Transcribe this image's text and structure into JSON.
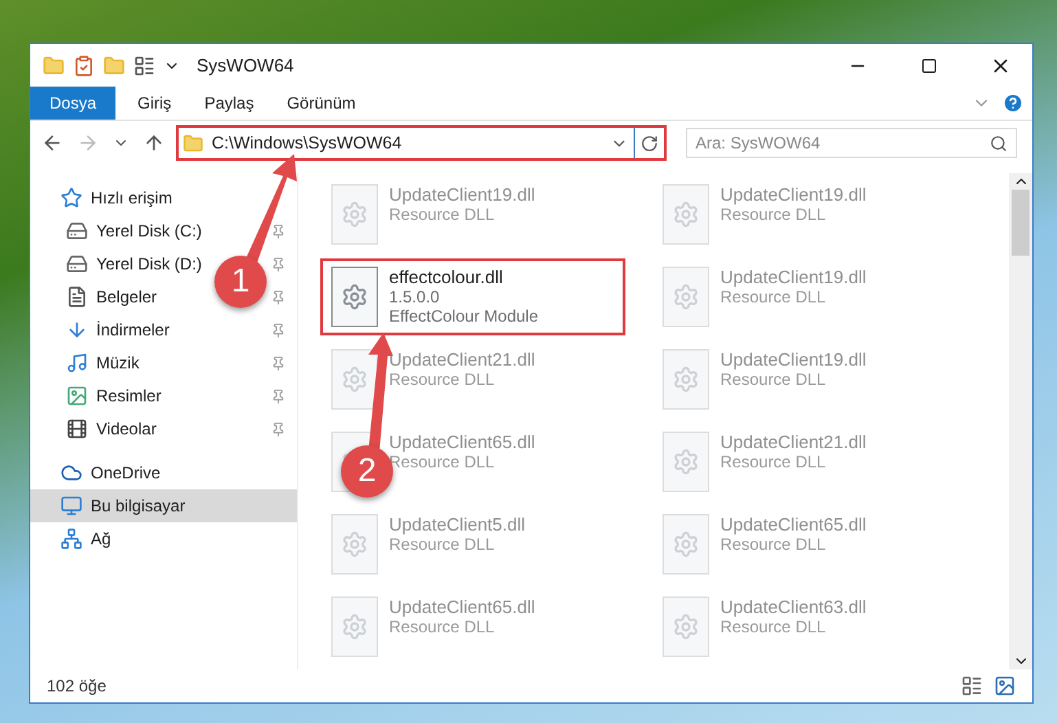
{
  "window": {
    "title": "SysWOW64"
  },
  "ribbon_tabs": [
    {
      "label": "Dosya",
      "selected": true
    },
    {
      "label": "Giriş",
      "selected": false
    },
    {
      "label": "Paylaş",
      "selected": false
    },
    {
      "label": "Görünüm",
      "selected": false
    }
  ],
  "address_bar": {
    "path": "C:\\Windows\\SysWOW64",
    "highlighted": true
  },
  "search": {
    "placeholder": "Ara: SysWOW64"
  },
  "sidebar": {
    "items": [
      {
        "label": "Hızlı erişim",
        "kind": "star",
        "selected": false,
        "children": [
          {
            "label": "Yerel Disk (C:)",
            "kind": "drive",
            "pinned": true
          },
          {
            "label": "Yerel Disk (D:)",
            "kind": "drive",
            "pinned": true
          },
          {
            "label": "Belgeler",
            "kind": "document",
            "pinned": true
          },
          {
            "label": "İndirmeler",
            "kind": "download",
            "pinned": true
          },
          {
            "label": "Müzik",
            "kind": "music",
            "pinned": true
          },
          {
            "label": "Resimler",
            "kind": "picture",
            "pinned": true
          },
          {
            "label": "Videolar",
            "kind": "video",
            "pinned": true
          }
        ]
      },
      {
        "label": "OneDrive",
        "kind": "cloud",
        "selected": false
      },
      {
        "label": "Bu bilgisayar",
        "kind": "computer",
        "selected": true
      },
      {
        "label": "Ağ",
        "kind": "network",
        "selected": false
      }
    ]
  },
  "files": [
    {
      "name": "UpdateClient19.dll",
      "lines": [
        "Resource DLL"
      ],
      "highlighted": false
    },
    {
      "name": "UpdateClient19.dll",
      "lines": [
        "Resource DLL"
      ],
      "highlighted": false
    },
    {
      "name": "effectcolour.dll",
      "lines": [
        "1.5.0.0",
        "EffectColour Module"
      ],
      "highlighted": true
    },
    {
      "name": "UpdateClient19.dll",
      "lines": [
        "Resource DLL"
      ],
      "highlighted": false
    },
    {
      "name": "UpdateClient21.dll",
      "lines": [
        "Resource DLL"
      ],
      "highlighted": false
    },
    {
      "name": "UpdateClient19.dll",
      "lines": [
        "Resource DLL"
      ],
      "highlighted": false
    },
    {
      "name": "UpdateClient65.dll",
      "lines": [
        "Resource DLL"
      ],
      "highlighted": false
    },
    {
      "name": "UpdateClient21.dll",
      "lines": [
        "Resource DLL"
      ],
      "highlighted": false
    },
    {
      "name": "UpdateClient5.dll",
      "lines": [
        "Resource DLL"
      ],
      "highlighted": false
    },
    {
      "name": "UpdateClient65.dll",
      "lines": [
        "Resource DLL"
      ],
      "highlighted": false
    },
    {
      "name": "UpdateClient65.dll",
      "lines": [
        "Resource DLL"
      ],
      "highlighted": false
    },
    {
      "name": "UpdateClient63.dll",
      "lines": [
        "Resource DLL"
      ],
      "highlighted": false
    }
  ],
  "status_bar": {
    "count": "102 öğe"
  },
  "annotations": [
    {
      "number": "1"
    },
    {
      "number": "2"
    }
  ]
}
